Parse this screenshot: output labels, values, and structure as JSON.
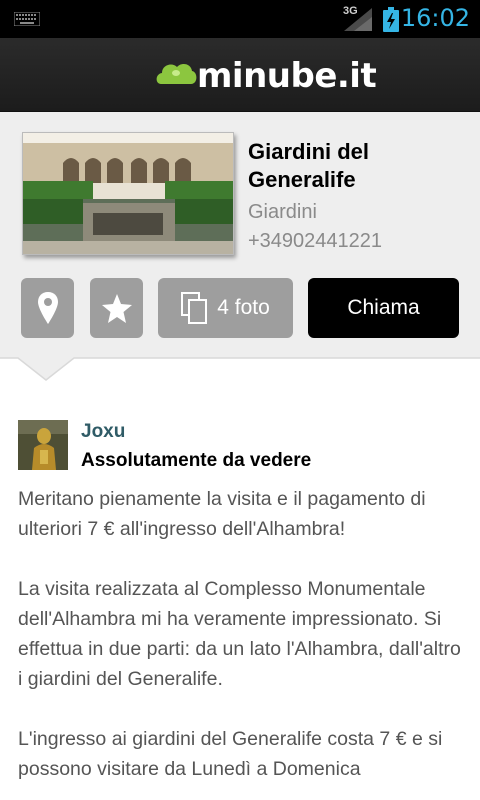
{
  "status_bar": {
    "network": "3G",
    "time": "16:02",
    "colors": {
      "clock": "#35b5e5"
    },
    "icons": [
      "keyboard-icon",
      "signal-icon",
      "battery-charging-icon"
    ]
  },
  "app_bar": {
    "logo_text": "minube.it",
    "colors": {
      "logo_blob": "#8cc63f",
      "background": "#222222"
    }
  },
  "place": {
    "name": "Giardini del Generalife",
    "category": "Giardini",
    "phone": "+34902441221",
    "actions": {
      "map_icon": "map-pin-icon",
      "favorite_icon": "star-icon",
      "photos_icon": "photos-stack-icon",
      "photos_label": "4 foto",
      "call_label": "Chiama"
    }
  },
  "review": {
    "author": "Joxu",
    "title": "Assolutamente da vedere",
    "paragraphs": [
      "Meritano pienamente la visita e il pagamento di ulteriori 7 € all'ingresso dell'Alhambra!",
      "La visita realizzata al Complesso Monumentale dell'Alhambra mi ha veramente impressionato. Si effettua in due parti: da un lato l'Alhambra, dall'altro i giardini del Generalife.",
      "L'ingresso ai giardini del Generalife costa 7 € e si possono visitare da Lunedì a Domenica"
    ],
    "colors": {
      "author": "#2f5b66"
    }
  }
}
